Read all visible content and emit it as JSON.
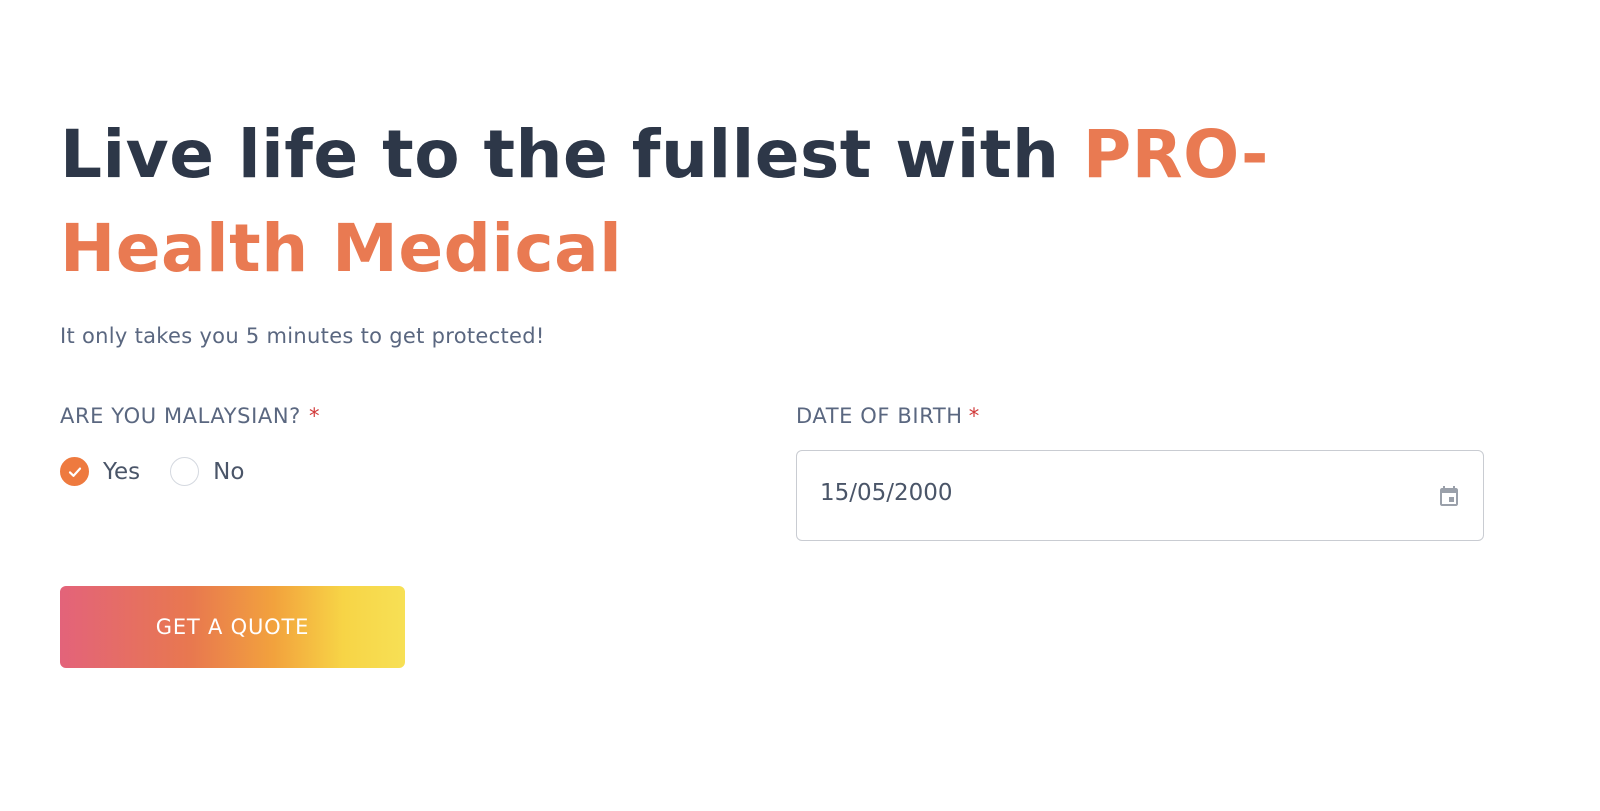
{
  "hero": {
    "title_main": "Live life to the fullest with ",
    "title_accent": "PRO-Health Medical",
    "subtitle": "It only takes you 5 minutes to get protected!"
  },
  "form": {
    "malaysian": {
      "label": "ARE YOU MALAYSIAN?",
      "required_marker": "*",
      "options": [
        {
          "label": "Yes",
          "selected": true
        },
        {
          "label": "No",
          "selected": false
        }
      ]
    },
    "dob": {
      "label": "DATE OF BIRTH",
      "required_marker": "*",
      "value": "15/05/2000",
      "icon": "calendar-icon"
    },
    "submit": {
      "label": "GET A QUOTE"
    }
  },
  "colors": {
    "heading": "#2d3748",
    "accent": "#e97a52",
    "text_muted": "#5a6780",
    "required": "#d23a3a",
    "radio_checked": "#ee7a3f",
    "button_gradient": [
      "#e3637a",
      "#e8784f",
      "#f2a23d",
      "#f7d446",
      "#f7e055"
    ]
  }
}
